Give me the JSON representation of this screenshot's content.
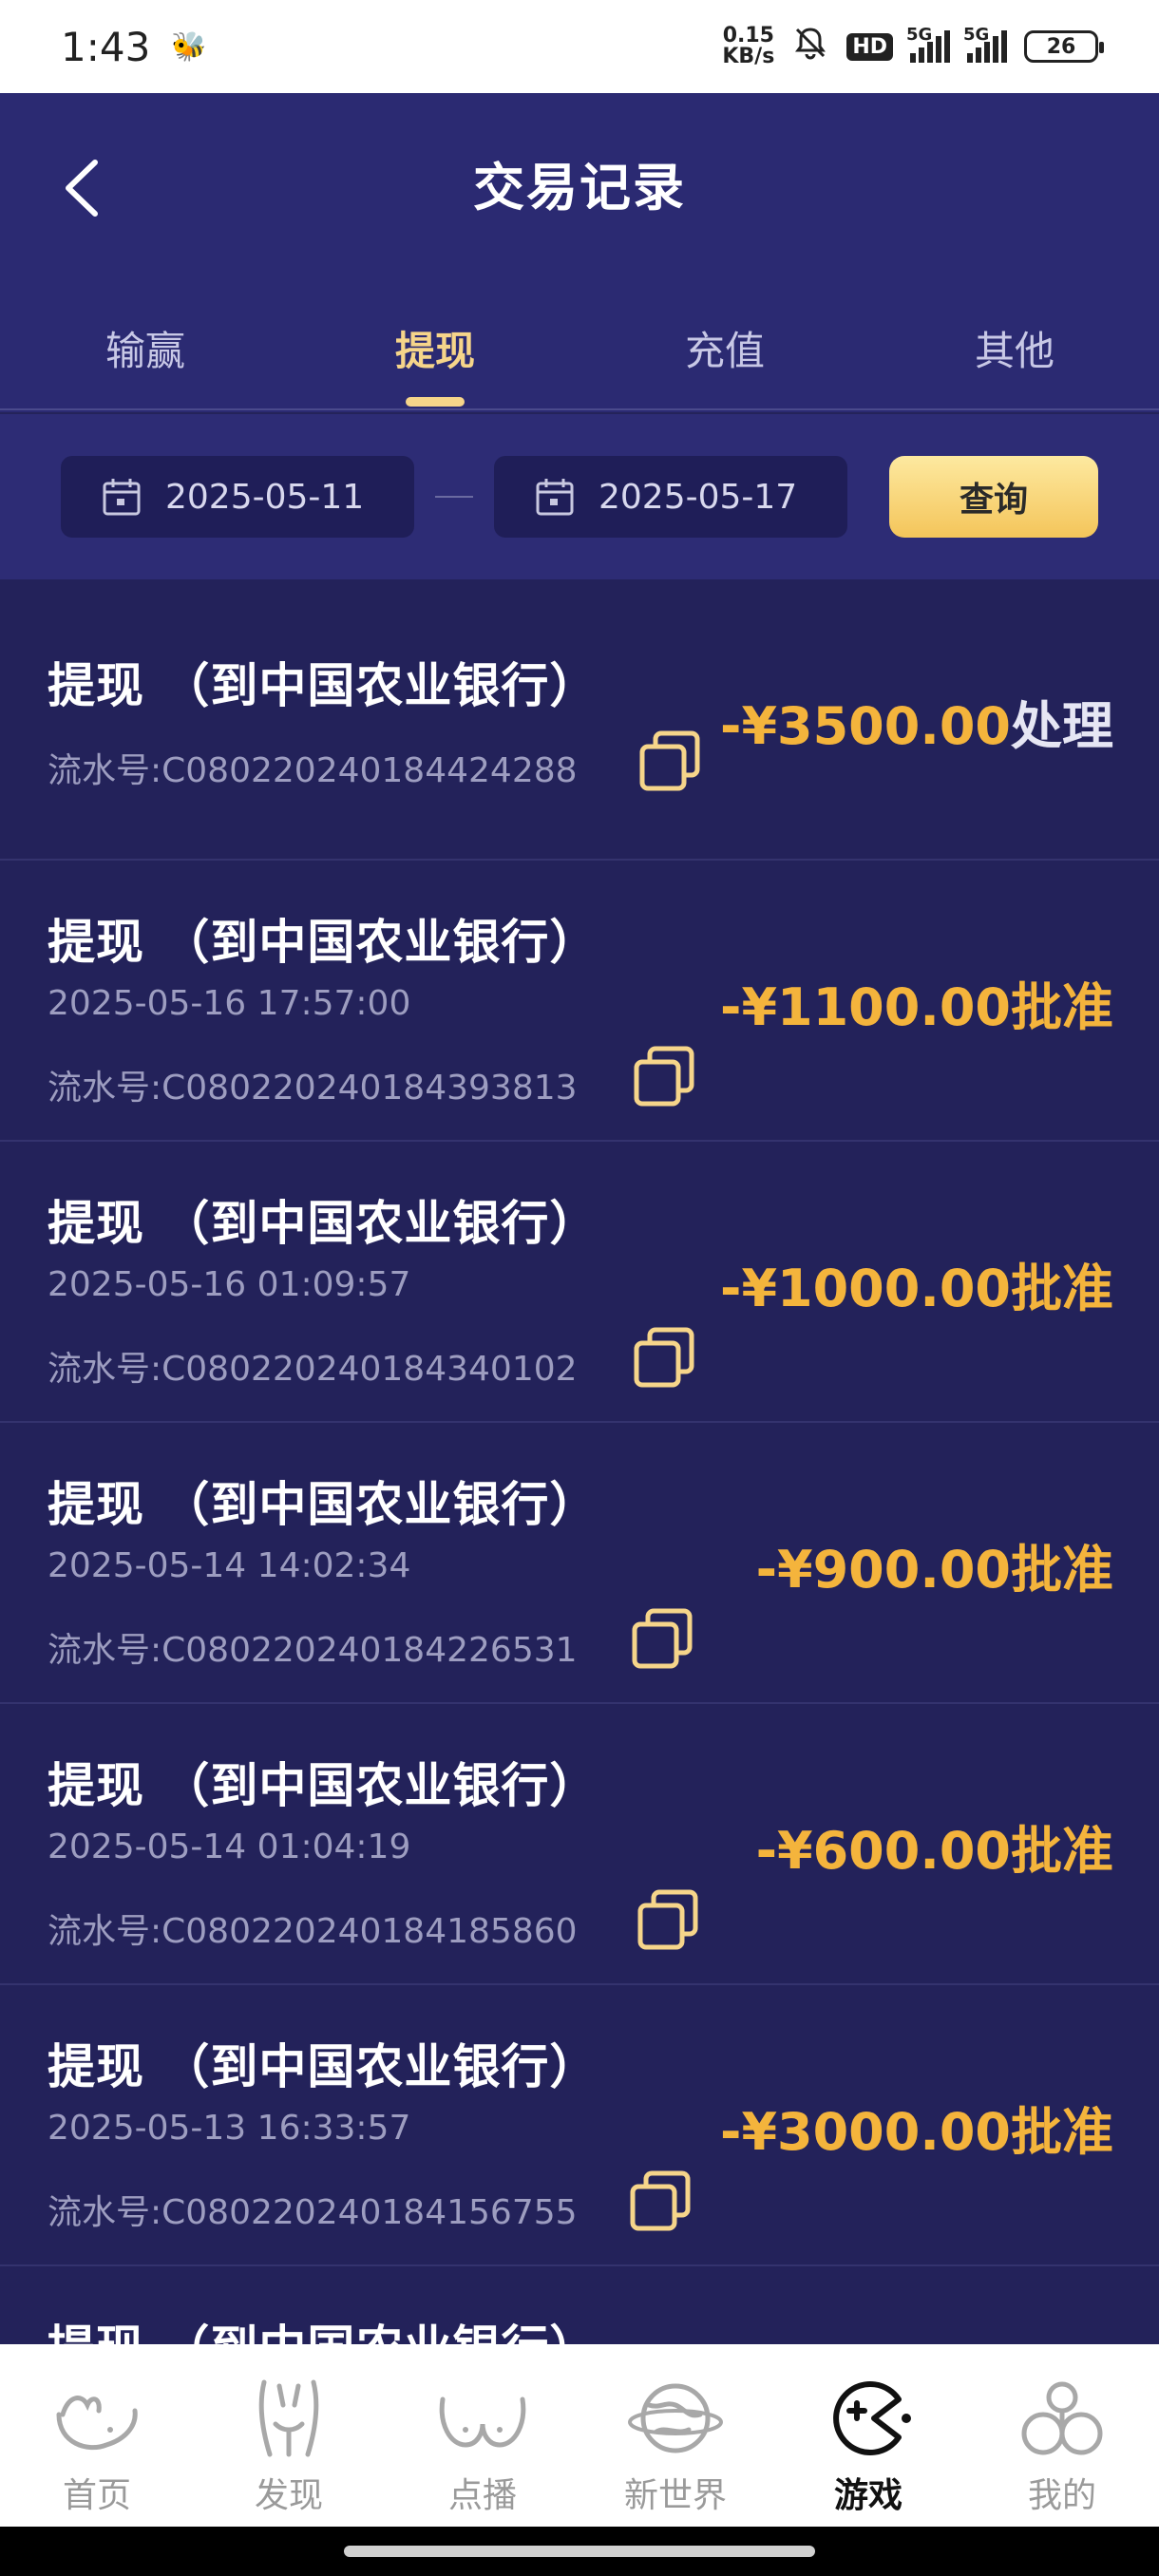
{
  "status_bar": {
    "time": "1:43",
    "net_speed_value": "0.15",
    "net_speed_unit": "KB/s",
    "hd_label": "HD",
    "sim1_gen": "5G",
    "sim2_gen": "5G",
    "battery": "26"
  },
  "header": {
    "title": "交易记录"
  },
  "tabs": [
    {
      "label": "输赢",
      "active": false
    },
    {
      "label": "提现",
      "active": true
    },
    {
      "label": "充值",
      "active": false
    },
    {
      "label": "其他",
      "active": false
    }
  ],
  "filter": {
    "start_date": "2025-05-11",
    "end_date": "2025-05-17",
    "query_label": "查询"
  },
  "records": [
    {
      "title": "提现 （到中国农业银行）",
      "time": "",
      "serial": "流水号:C080220240184424288",
      "amount": "-¥3500.00",
      "status": "处理"
    },
    {
      "title": "提现 （到中国农业银行）",
      "time": "2025-05-16 17:57:00",
      "serial": "流水号:C080220240184393813",
      "amount": "-¥1100.00",
      "status": "批准"
    },
    {
      "title": "提现 （到中国农业银行）",
      "time": "2025-05-16 01:09:57",
      "serial": "流水号:C080220240184340102",
      "amount": "-¥1000.00",
      "status": "批准"
    },
    {
      "title": "提现 （到中国农业银行）",
      "time": "2025-05-14 14:02:34",
      "serial": "流水号:C080220240184226531",
      "amount": "-¥900.00",
      "status": "批准"
    },
    {
      "title": "提现 （到中国农业银行）",
      "time": "2025-05-14 01:04:19",
      "serial": "流水号:C080220240184185860",
      "amount": "-¥600.00",
      "status": "批准"
    },
    {
      "title": "提现 （到中国农业银行）",
      "time": "2025-05-13 16:33:57",
      "serial": "流水号:C080220240184156755",
      "amount": "-¥3000.00",
      "status": "批准"
    },
    {
      "title": "提现 （到中国农业银行）",
      "time": "",
      "serial": "",
      "amount": "",
      "status": ""
    }
  ],
  "bottom_nav": [
    {
      "label": "首页",
      "icon": "home-icon",
      "active": false
    },
    {
      "label": "发现",
      "icon": "discover-icon",
      "active": false
    },
    {
      "label": "点播",
      "icon": "on-demand-icon",
      "active": false
    },
    {
      "label": "新世界",
      "icon": "planet-icon",
      "active": false
    },
    {
      "label": "游戏",
      "icon": "game-icon",
      "active": true
    },
    {
      "label": "我的",
      "icon": "profile-icon",
      "active": false
    }
  ],
  "colors": {
    "header_bg": "#2b2a72",
    "list_bg": "#23225a",
    "accent_gold": "#f6d58a",
    "amount_orange": "#f4b43c"
  }
}
